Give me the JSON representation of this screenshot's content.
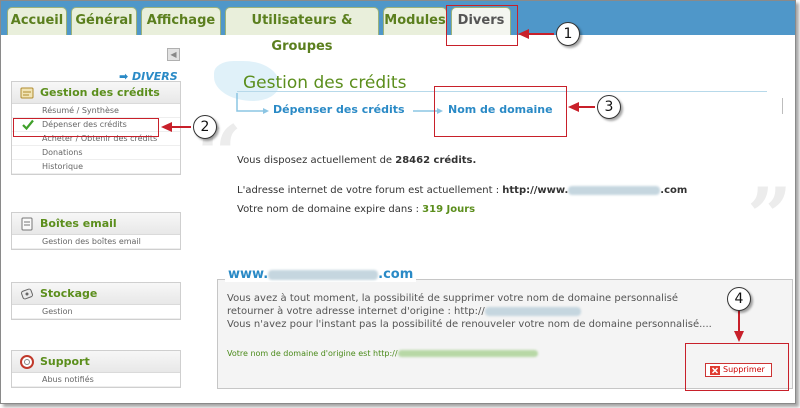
{
  "tabs": [
    {
      "label": "Accueil"
    },
    {
      "label": "Général"
    },
    {
      "label": "Affichage"
    },
    {
      "label": "Utilisateurs & Groupes"
    },
    {
      "label": "Modules"
    },
    {
      "label": "Divers"
    }
  ],
  "sidebar": {
    "divers_link": "➡ DIVERS",
    "panels": [
      {
        "title": "Gestion des crédits",
        "icon": "credits-icon",
        "items": [
          "Résumé / Synthèse",
          "Dépenser des crédits",
          "Acheter / Obtenir des crédits",
          "Donations",
          "Historique"
        ]
      },
      {
        "title": "Boîtes email",
        "icon": "email-icon",
        "items": [
          "Gestion des boîtes email"
        ]
      },
      {
        "title": "Stockage",
        "icon": "storage-icon",
        "items": [
          "Gestion"
        ]
      },
      {
        "title": "Support",
        "icon": "lifebuoy-icon",
        "items": [
          "Abus notifiés"
        ]
      }
    ]
  },
  "main": {
    "title": "Gestion des crédits",
    "breadcrumb": [
      "Dépenser des crédits",
      "Nom de domaine"
    ],
    "credits_prefix": "Vous disposez actuellement de",
    "credits_value": "28462 crédits.",
    "forum_address_label": "L'adresse internet de votre forum est actuellement :",
    "forum_address_prefix": "http://www.",
    "forum_address_suffix": ".com",
    "expire_label": "Votre nom de domaine expire dans :",
    "expire_value": "319 Jours",
    "domain_box": {
      "legend_prefix": "www.",
      "legend_suffix": ".com",
      "line1": "Vous avez à tout moment, la possibilité de supprimer votre nom de domaine personnalisé",
      "line2_prefix": "retourner à votre adresse internet d'origine : http://",
      "line3": "Vous n'avez pour l'instant pas la possibilité de renouveler votre nom de domaine personnalisé....",
      "origin_label": "Votre nom de domaine d'origine est http://",
      "delete_label": "Supprimer"
    }
  },
  "annotations": [
    "1",
    "2",
    "3",
    "4"
  ],
  "colors": {
    "tabbar": "#4f97c9",
    "accent_green": "#5b8e1c",
    "accent_blue": "#2a8ac6",
    "annotation_red": "#c8202a"
  }
}
